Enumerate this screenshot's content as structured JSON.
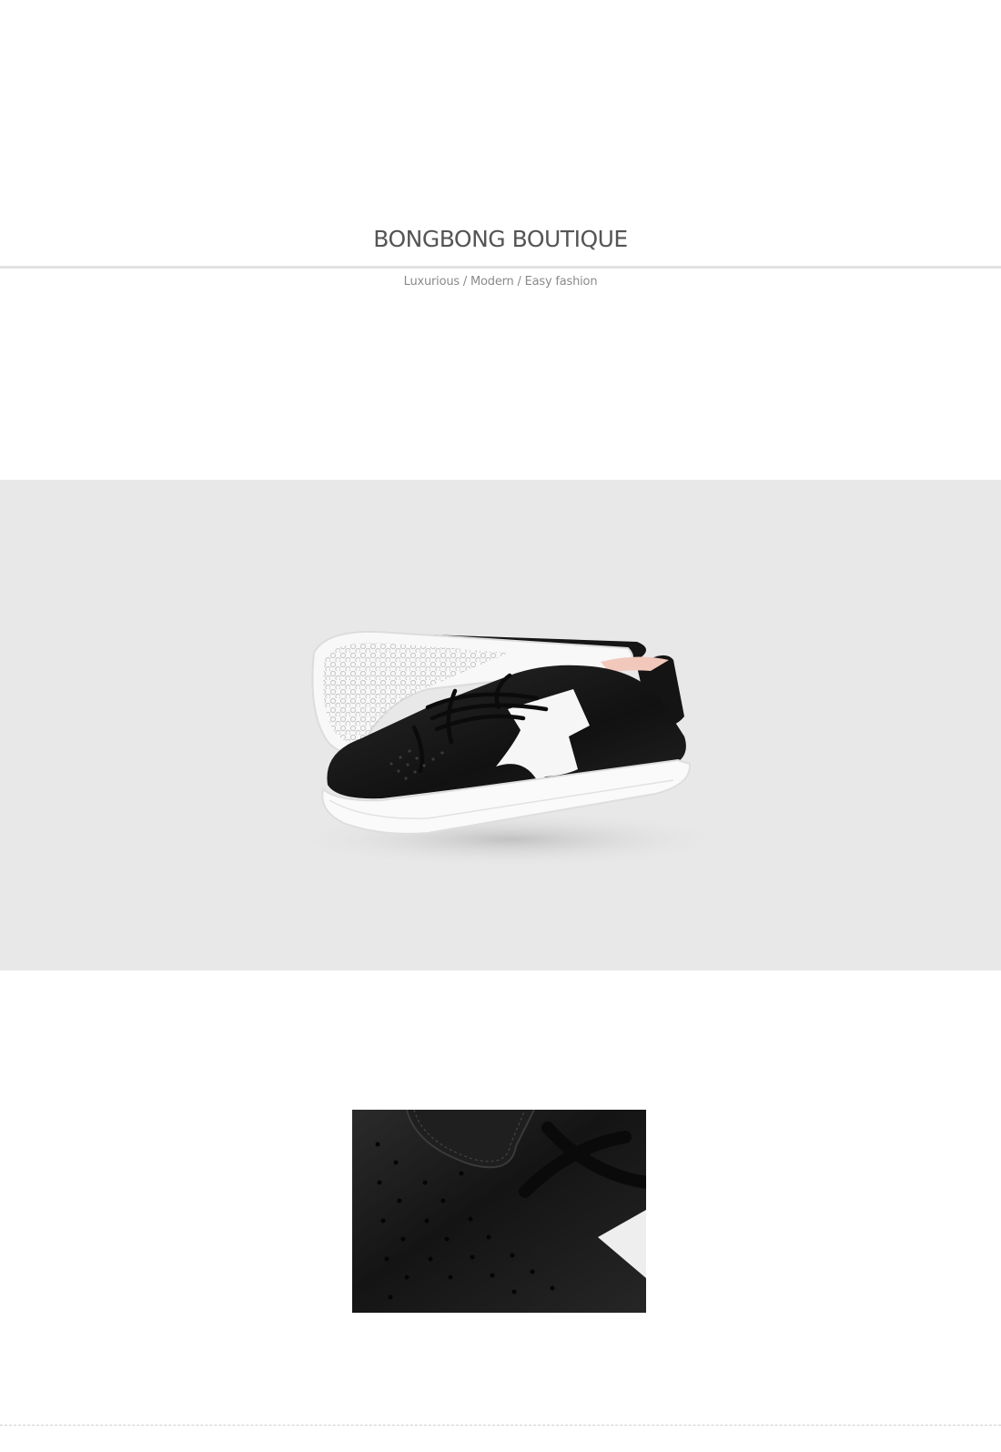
{
  "header": {
    "brand": "BONGBONG BOUTIQUE",
    "tagline": "Luxurious / Modern / Easy fashion"
  },
  "images": {
    "hero": {
      "subject": "black-and-white-leather-sneakers",
      "background_color": "#e8e8e8"
    },
    "detail": {
      "subject": "perforated-leather-toe-closeup",
      "background_color": "#1c1c1c"
    }
  },
  "colors": {
    "brand_text": "#555555",
    "tagline_text": "#8a8a8a",
    "divider": "#e2e2e2",
    "footer_divider": "#cfcfcf"
  }
}
